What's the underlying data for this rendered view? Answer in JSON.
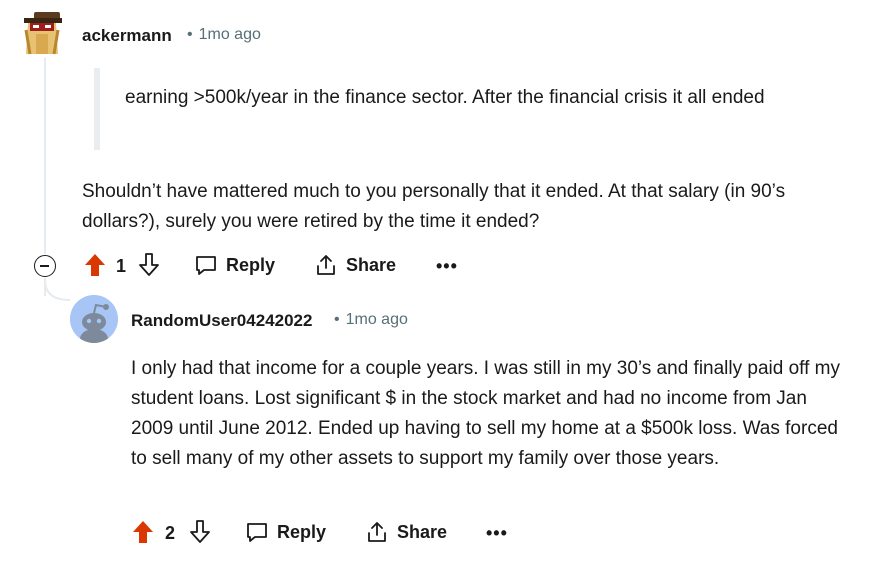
{
  "comment1": {
    "username": "ackermann",
    "timestamp": "1mo ago",
    "quote": "earning >500k/year in the finance sector. After the financial crisis it all ended",
    "body": "Shouldn’t have mattered much to you personally that it ended. At that salary (in 90’s dollars?), surely you were retired by the time it ended?",
    "votes": "1",
    "reply_label": "Reply",
    "share_label": "Share",
    "more_label": "•••",
    "upvote_color": "#d93900"
  },
  "comment2": {
    "username": "RandomUser04242022",
    "timestamp": "1mo ago",
    "body": "I only had that income for a couple years. I was still in my 30’s and finally paid off my student loans. Lost significant $ in the stock market and had no income from Jan 2009 until June 2012. Ended up having to sell my home at a $500k loss. Was forced to sell many of my other assets to support my family over those years.",
    "votes": "2",
    "reply_label": "Reply",
    "share_label": "Share",
    "more_label": "•••",
    "upvote_color": "#d93900"
  },
  "separator": "•"
}
